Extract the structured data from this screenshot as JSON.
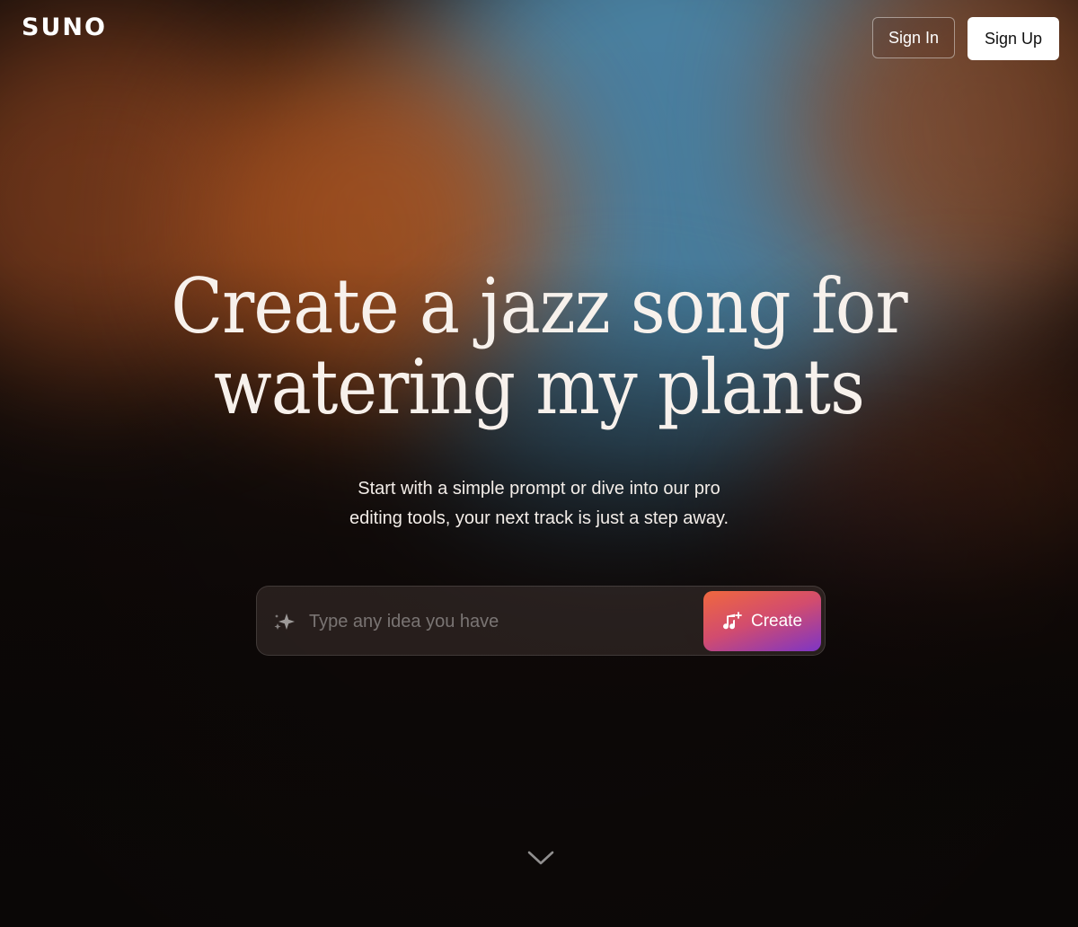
{
  "header": {
    "logo": "SUNO",
    "sign_in_label": "Sign In",
    "sign_up_label": "Sign Up"
  },
  "hero": {
    "headline_line1": "Create a jazz song for",
    "headline_line2": "watering my plants",
    "subtext_line1": "Start with a simple prompt or dive into our pro",
    "subtext_line2": "editing tools, your next track is just a step away."
  },
  "prompt": {
    "placeholder": "Type any idea you have",
    "value": "",
    "leading_icon": "sparkle-icon",
    "create_label": "Create",
    "create_icon": "music-note-plus-icon"
  },
  "footer": {
    "scroll_icon": "chevron-down-icon"
  },
  "colors": {
    "create_gradient_start": "#f0683e",
    "create_gradient_end": "#7d35c6",
    "background_blue": "#4c86a8",
    "background_orange": "#a8521f"
  }
}
